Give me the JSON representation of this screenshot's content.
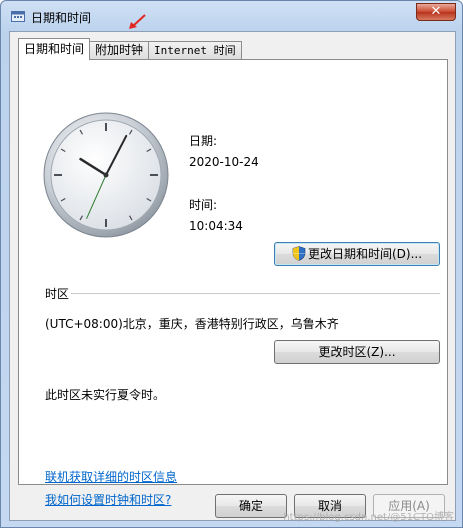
{
  "window": {
    "title": "日期和时间",
    "close_label": "✕"
  },
  "tabs": [
    {
      "label": "日期和时间"
    },
    {
      "label": "附加时钟"
    },
    {
      "label": "Internet 时间"
    }
  ],
  "date": {
    "label": "日期:",
    "value": "2020-10-24"
  },
  "time": {
    "label": "时间:",
    "value": "10:04:34"
  },
  "clock": {
    "hour": 10,
    "minute": 4,
    "second": 34
  },
  "buttons": {
    "change_datetime": "更改日期和时间(D)...",
    "change_timezone": "更改时区(Z)...",
    "ok": "确定",
    "cancel": "取消",
    "apply": "应用(A)"
  },
  "timezone": {
    "heading": "时区",
    "value": "(UTC+08:00)北京，重庆，香港特别行政区，乌鲁木齐",
    "dst_note": "此时区未实行夏令时。"
  },
  "links": {
    "more_info": "联机获取详细的时区信息",
    "how_to": "我如何设置时钟和时区?"
  },
  "watermark": "https://blog.csdn.net/@51CTO博客"
}
